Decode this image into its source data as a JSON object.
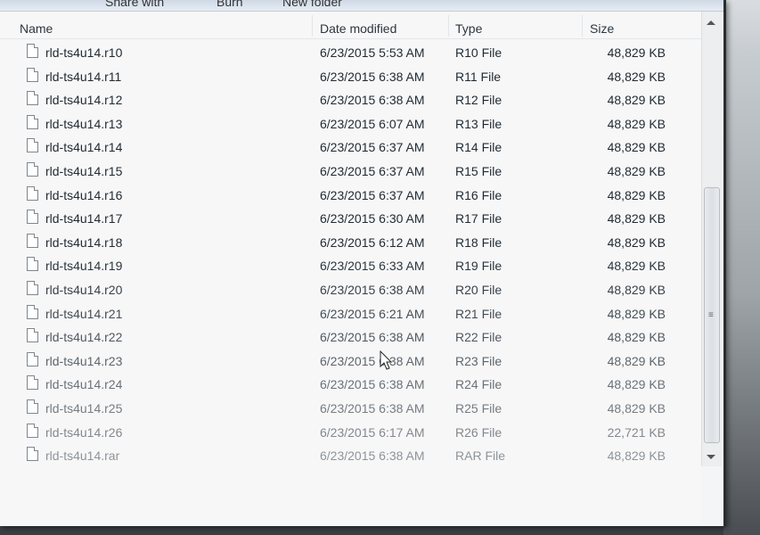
{
  "toolbar": {
    "items": [
      "Share with",
      "Burn",
      "New folder"
    ]
  },
  "columns": {
    "name": "Name",
    "date": "Date modified",
    "type": "Type",
    "size": "Size"
  },
  "files": [
    {
      "name": "rld-ts4u14.r10",
      "date": "6/23/2015 5:53 AM",
      "type": "R10 File",
      "size": "48,829 KB"
    },
    {
      "name": "rld-ts4u14.r11",
      "date": "6/23/2015 6:38 AM",
      "type": "R11 File",
      "size": "48,829 KB"
    },
    {
      "name": "rld-ts4u14.r12",
      "date": "6/23/2015 6:38 AM",
      "type": "R12 File",
      "size": "48,829 KB"
    },
    {
      "name": "rld-ts4u14.r13",
      "date": "6/23/2015 6:07 AM",
      "type": "R13 File",
      "size": "48,829 KB"
    },
    {
      "name": "rld-ts4u14.r14",
      "date": "6/23/2015 6:37 AM",
      "type": "R14 File",
      "size": "48,829 KB"
    },
    {
      "name": "rld-ts4u14.r15",
      "date": "6/23/2015 6:37 AM",
      "type": "R15 File",
      "size": "48,829 KB"
    },
    {
      "name": "rld-ts4u14.r16",
      "date": "6/23/2015 6:37 AM",
      "type": "R16 File",
      "size": "48,829 KB"
    },
    {
      "name": "rld-ts4u14.r17",
      "date": "6/23/2015 6:30 AM",
      "type": "R17 File",
      "size": "48,829 KB"
    },
    {
      "name": "rld-ts4u14.r18",
      "date": "6/23/2015 6:12 AM",
      "type": "R18 File",
      "size": "48,829 KB"
    },
    {
      "name": "rld-ts4u14.r19",
      "date": "6/23/2015 6:33 AM",
      "type": "R19 File",
      "size": "48,829 KB"
    },
    {
      "name": "rld-ts4u14.r20",
      "date": "6/23/2015 6:38 AM",
      "type": "R20 File",
      "size": "48,829 KB"
    },
    {
      "name": "rld-ts4u14.r21",
      "date": "6/23/2015 6:21 AM",
      "type": "R21 File",
      "size": "48,829 KB"
    },
    {
      "name": "rld-ts4u14.r22",
      "date": "6/23/2015 6:38 AM",
      "type": "R22 File",
      "size": "48,829 KB"
    },
    {
      "name": "rld-ts4u14.r23",
      "date": "6/23/2015 6:38 AM",
      "type": "R23 File",
      "size": "48,829 KB"
    },
    {
      "name": "rld-ts4u14.r24",
      "date": "6/23/2015 6:38 AM",
      "type": "R24 File",
      "size": "48,829 KB"
    },
    {
      "name": "rld-ts4u14.r25",
      "date": "6/23/2015 6:38 AM",
      "type": "R25 File",
      "size": "48,829 KB"
    },
    {
      "name": "rld-ts4u14.r26",
      "date": "6/23/2015 6:17 AM",
      "type": "R26 File",
      "size": "22,721 KB"
    },
    {
      "name": "rld-ts4u14.rar",
      "date": "6/23/2015 6:38 AM",
      "type": "RAR File",
      "size": "48,829 KB"
    }
  ],
  "icons": {
    "file": "file-icon",
    "cursor": "mouse-cursor-icon",
    "scroll_up": "scroll-up-arrow-icon",
    "scroll_down": "scroll-down-arrow-icon"
  },
  "colors": {
    "text_dark": "#1f2a33",
    "text_faded": "#8e949a",
    "window_bg": "#f7f7f7"
  }
}
